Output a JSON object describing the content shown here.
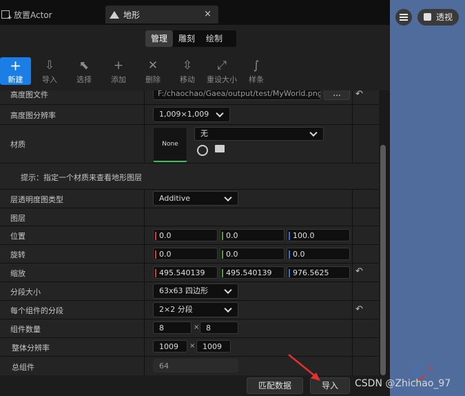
{
  "tabs": {
    "place_actor": "放置Actor",
    "landscape": "地形",
    "close": "×"
  },
  "modes": [
    "管理",
    "雕刻",
    "绘制"
  ],
  "toolbar": {
    "new": "新建",
    "import": "导入",
    "select": "选择",
    "add": "添加",
    "delete": "删除",
    "move": "移动",
    "resize": "重设大小",
    "spline": "样条"
  },
  "details": {
    "heightmap_file_label": "高度图文件",
    "heightmap_file_value": "F:/chaochao/Gaea/output/test/MyWorld.png",
    "heightmap_file_browse": "...",
    "heightmap_res_label": "高度图分辨率",
    "heightmap_res_value": "1,009×1,009",
    "material_label": "材质",
    "material_thumb": "None",
    "material_value": "无",
    "hint": "提示：指定一个材质来查看地形图层",
    "layer_blend_label": "层透明度图类型",
    "layer_blend_value": "Additive",
    "layers_label": "图层",
    "location_label": "位置",
    "location": [
      "0.0",
      "0.0",
      "100.0"
    ],
    "rotation_label": "旋转",
    "rotation": [
      "0.0",
      "0.0",
      "0.0"
    ],
    "scale_label": "缩放",
    "scale": [
      "495.540139",
      "495.540139",
      "976.5625"
    ],
    "section_size_label": "分段大小",
    "section_size_value": "63x63 四边形",
    "sections_per_comp_label": "每个组件的分段",
    "sections_per_comp_value": "2×2 分段",
    "comp_count_label": "组件数量",
    "comp_count": [
      "8",
      "8"
    ],
    "overall_res_label": "整体分辨率",
    "overall_res": [
      "1009",
      "1009"
    ],
    "total_comp_label": "总组件",
    "total_comp_value": "64",
    "times": "×"
  },
  "buttons": {
    "fit_data": "匹配数据",
    "import": "导入"
  },
  "viewport": {
    "perspective": "透视",
    "axis_z": "Z",
    "axis_x": "X"
  },
  "watermark": "CSDN @Zhichao_97",
  "colors": {
    "accent_blue": "#1a7ee6",
    "axis_red": "#d23a3a",
    "axis_green": "#5f9a3a",
    "axis_blue": "#3a6fd2",
    "viewport_bg": "#4f6c9c"
  }
}
